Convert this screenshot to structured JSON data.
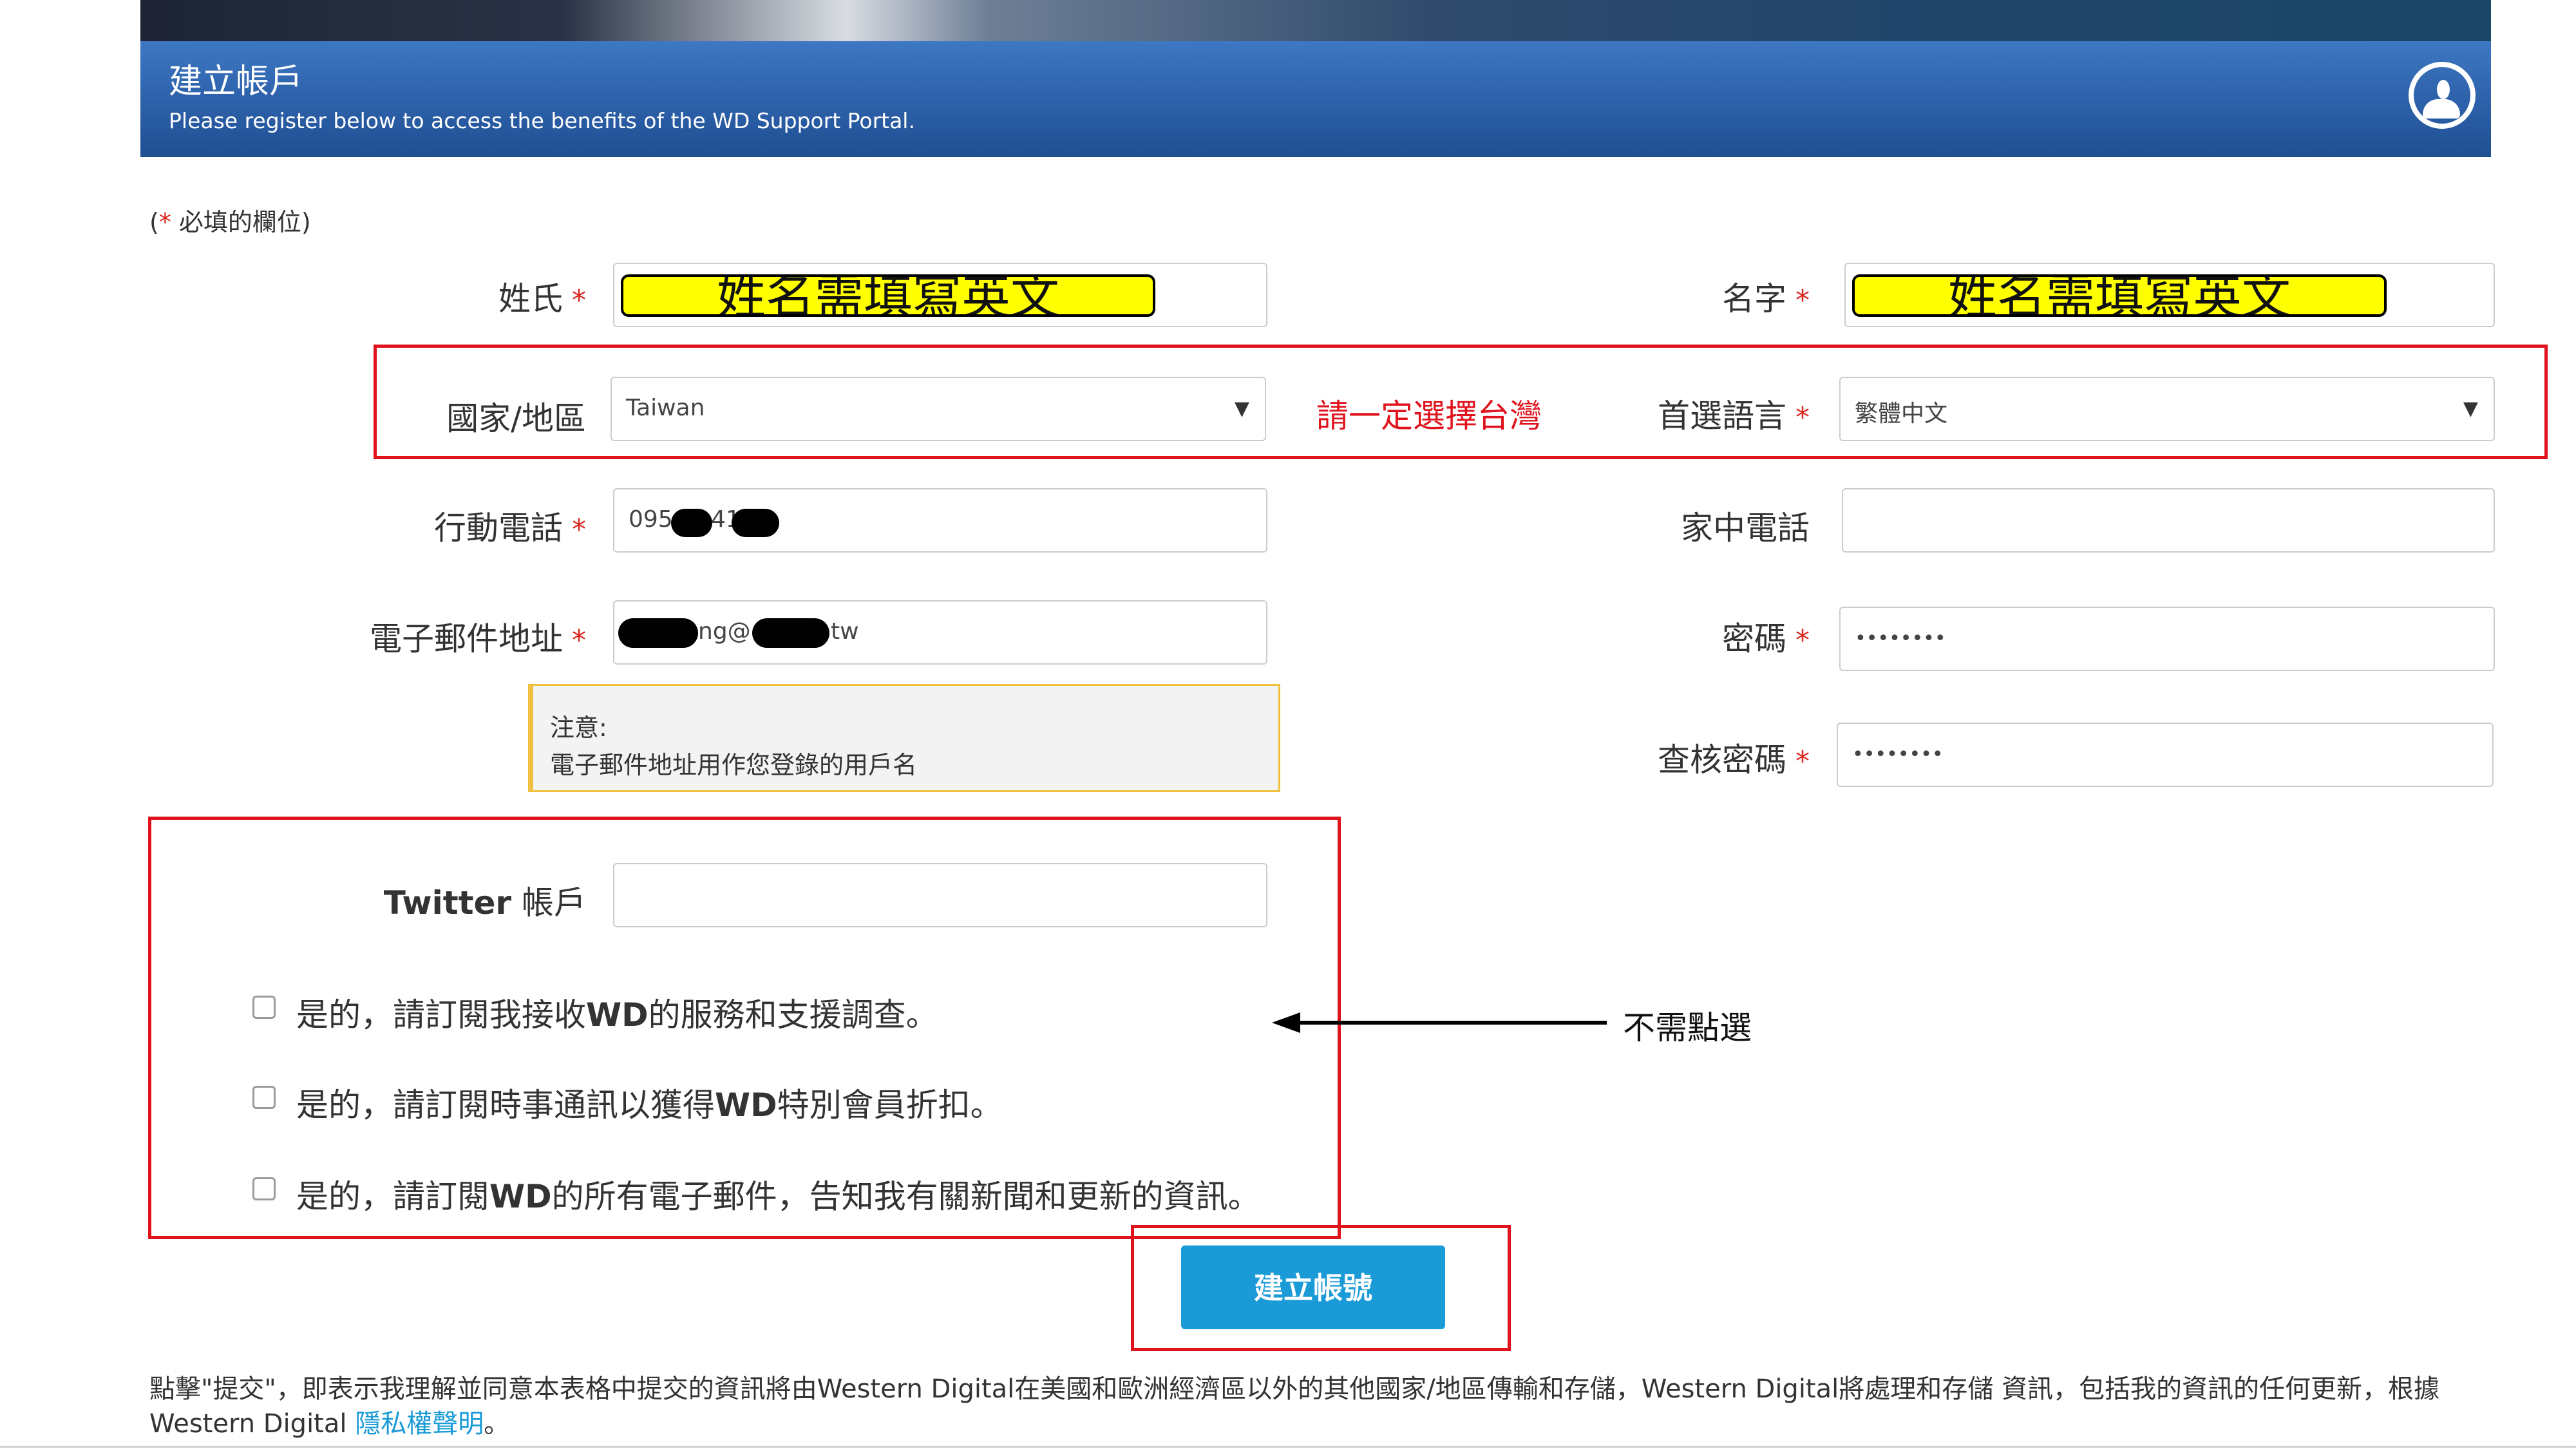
{
  "header": {
    "title": "建立帳戶",
    "subtitle": "Please register below to access the benefits of the WD Support Portal.",
    "user_icon": "user-circle-icon"
  },
  "required_note": {
    "open": "(",
    "star": "*",
    "text": " 必填的欄位)"
  },
  "required_star": "*",
  "form": {
    "last_name": {
      "label": "姓氏",
      "highlight": "姓名需填寫英文"
    },
    "first_name": {
      "label": "名字",
      "highlight": "姓名需填寫英文"
    },
    "country": {
      "label": "國家/地區",
      "value": "Taiwan",
      "caret": "▼"
    },
    "country_annotation": "請一定選擇台灣",
    "language": {
      "label": "首選語言",
      "value": "繁體中文",
      "caret": "▼"
    },
    "mobile": {
      "label": "行動電話",
      "value_prefix": "095",
      "value_mid": "41"
    },
    "home_phone": {
      "label": "家中電話",
      "value": ""
    },
    "email": {
      "label": "電子郵件地址",
      "value_mid": "ng@",
      "value_suffix": "tw"
    },
    "password": {
      "label": "密碼",
      "value": "••••••••"
    },
    "confirm_password": {
      "label": "查核密碼",
      "value": "••••••••"
    },
    "note": {
      "title": "注意:",
      "body": "電子郵件地址用作您登錄的用戶名"
    },
    "twitter": {
      "label_bold": "Twitter",
      "label_rest": " 帳戶",
      "value": ""
    }
  },
  "subscriptions": [
    {
      "pre": "是的，請訂閱我接收",
      "bold": "WD",
      "post": "的服務和支援調查。"
    },
    {
      "pre": "是的，請訂閱時事通訊以獲得",
      "bold": "WD",
      "post": "特別會員折扣。"
    },
    {
      "pre": "是的，請訂閱",
      "bold": "WD",
      "post": "的所有電子郵件，告知我有關新聞和更新的資訊。"
    }
  ],
  "arrow_annotation": "不需點選",
  "submit_label": "建立帳號",
  "legal": {
    "text": "點擊\"提交\"，即表示我理解並同意本表格中提交的資訊將由Western Digital在美國和歐洲經濟區以外的其他國家/地區傳輸和存儲，Western Digital將處理和存儲 資訊，包括我的資訊的任何更新，根據Western Digital ",
    "link": "隱私權聲明",
    "end": "。"
  },
  "colors": {
    "header_blue": "#2f64ad",
    "button_blue": "#1a9ad6",
    "required_red": "#d9251c",
    "annotation_red": "#e0121c",
    "highlight_yellow": "#ffff00"
  }
}
